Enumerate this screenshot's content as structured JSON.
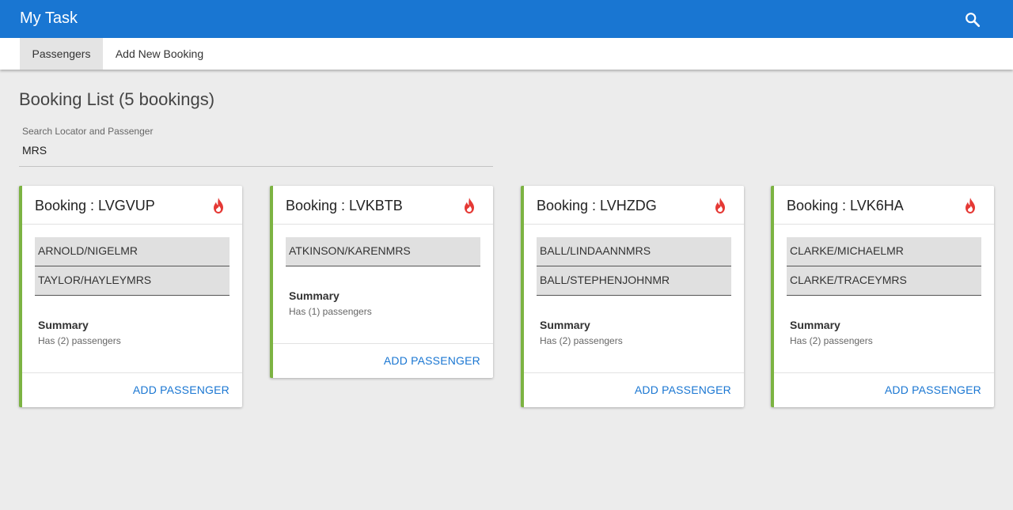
{
  "app": {
    "title": "My Task"
  },
  "tabs": [
    {
      "label": "Passengers",
      "active": true
    },
    {
      "label": "Add New Booking",
      "active": false
    }
  ],
  "page_title": "Booking List (5 bookings)",
  "search": {
    "label": "Search Locator and Passenger",
    "value": "MRS"
  },
  "bookings": [
    {
      "title": "Booking : LVGVUP",
      "passengers": [
        "ARNOLD/NIGELMR",
        "TAYLOR/HAYLEYMRS"
      ],
      "summary_title": "Summary",
      "summary_text": "Has (2) passengers",
      "action": "ADD PASSENGER"
    },
    {
      "title": "Booking : LVKBTB",
      "passengers": [
        "ATKINSON/KARENMRS"
      ],
      "summary_title": "Summary",
      "summary_text": "Has (1) passengers",
      "action": "ADD PASSENGER"
    },
    {
      "title": "Booking : LVHZDG",
      "passengers": [
        "BALL/LINDAANNMRS",
        "BALL/STEPHENJOHNMR"
      ],
      "summary_title": "Summary",
      "summary_text": "Has (2) passengers",
      "action": "ADD PASSENGER"
    },
    {
      "title": "Booking : LVK6HA",
      "passengers": [
        "CLARKE/MICHAELMR",
        "CLARKE/TRACEYMRS"
      ],
      "summary_title": "Summary",
      "summary_text": "Has (2) passengers",
      "action": "ADD PASSENGER"
    }
  ],
  "icons": {
    "search": "search-icon",
    "hot": "fire-icon"
  },
  "colors": {
    "primary": "#1976d2",
    "accent": "#7cb342",
    "fire": "#e53935"
  }
}
